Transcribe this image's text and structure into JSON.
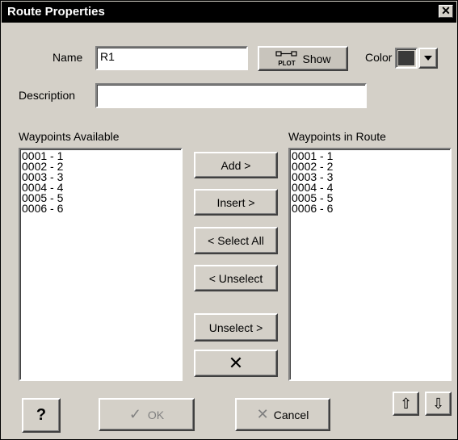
{
  "window": {
    "title": "Route Properties",
    "close_glyph": "✕"
  },
  "name_row": {
    "label": "Name",
    "value": "R1",
    "show_button": "Show",
    "plot_icon_text": "PLOT",
    "color_label": "Color",
    "color_value": "#3a3a3a"
  },
  "description": {
    "label": "Description",
    "value": ""
  },
  "available": {
    "label": "Waypoints Available",
    "items": [
      "0001 - 1",
      "0002 - 2",
      "0003 - 3",
      "0004 - 4",
      "0005 - 5",
      "0006 - 6"
    ]
  },
  "route": {
    "label": "Waypoints in Route",
    "items": [
      "0001 - 1",
      "0002 - 2",
      "0003 - 3",
      "0004 - 4",
      "0005 - 5",
      "0006 - 6"
    ]
  },
  "buttons": {
    "add": "Add >",
    "insert": "Insert >",
    "select_all": "< Select All",
    "unselect_left": "< Unselect",
    "unselect_right": "Unselect >",
    "delete_glyph": "✕",
    "help": "?",
    "ok": "OK",
    "ok_glyph": "✓",
    "cancel": "Cancel",
    "cancel_glyph": "✕",
    "up": "⇧",
    "down": "⇩"
  }
}
